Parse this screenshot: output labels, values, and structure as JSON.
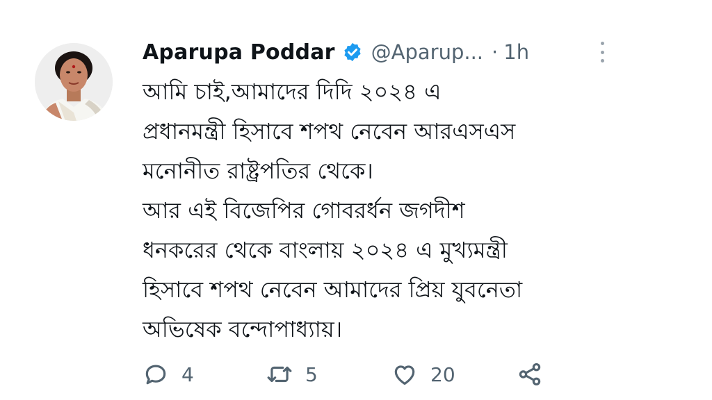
{
  "tweet": {
    "author_name": "Aparupa Poddar",
    "handle": "@Aparup...",
    "separator": "·",
    "time": "1h",
    "verified_icon": "verified-badge-icon",
    "more_icon": "more-vertical-icon",
    "lines": [
      "আমি চাই,আমাদের দিদি ২০২৪ এ",
      "প্রধানমন্ত্রী হিসাবে শপথ নেবেন আরএসএস",
      "মনোনীত রাষ্ট্রপতির থেকে।",
      "আর এই বিজেপির গোবরর্ধন জগদীশ",
      "ধনকরের থেকে বাংলায় ২০২৪ এ মুখ্যমন্ত্রী",
      "হিসাবে শপথ নেবেন আমাদের প্রিয় যুবনেতা",
      "অভিষেক বন্দোপাধ্যায়।"
    ],
    "actions": {
      "reply_count": "4",
      "retweet_count": "5",
      "like_count": "20"
    }
  },
  "colors": {
    "text": "#0f1419",
    "secondary": "#536471",
    "verified": "#1d9bf0",
    "icon": "#536471"
  }
}
